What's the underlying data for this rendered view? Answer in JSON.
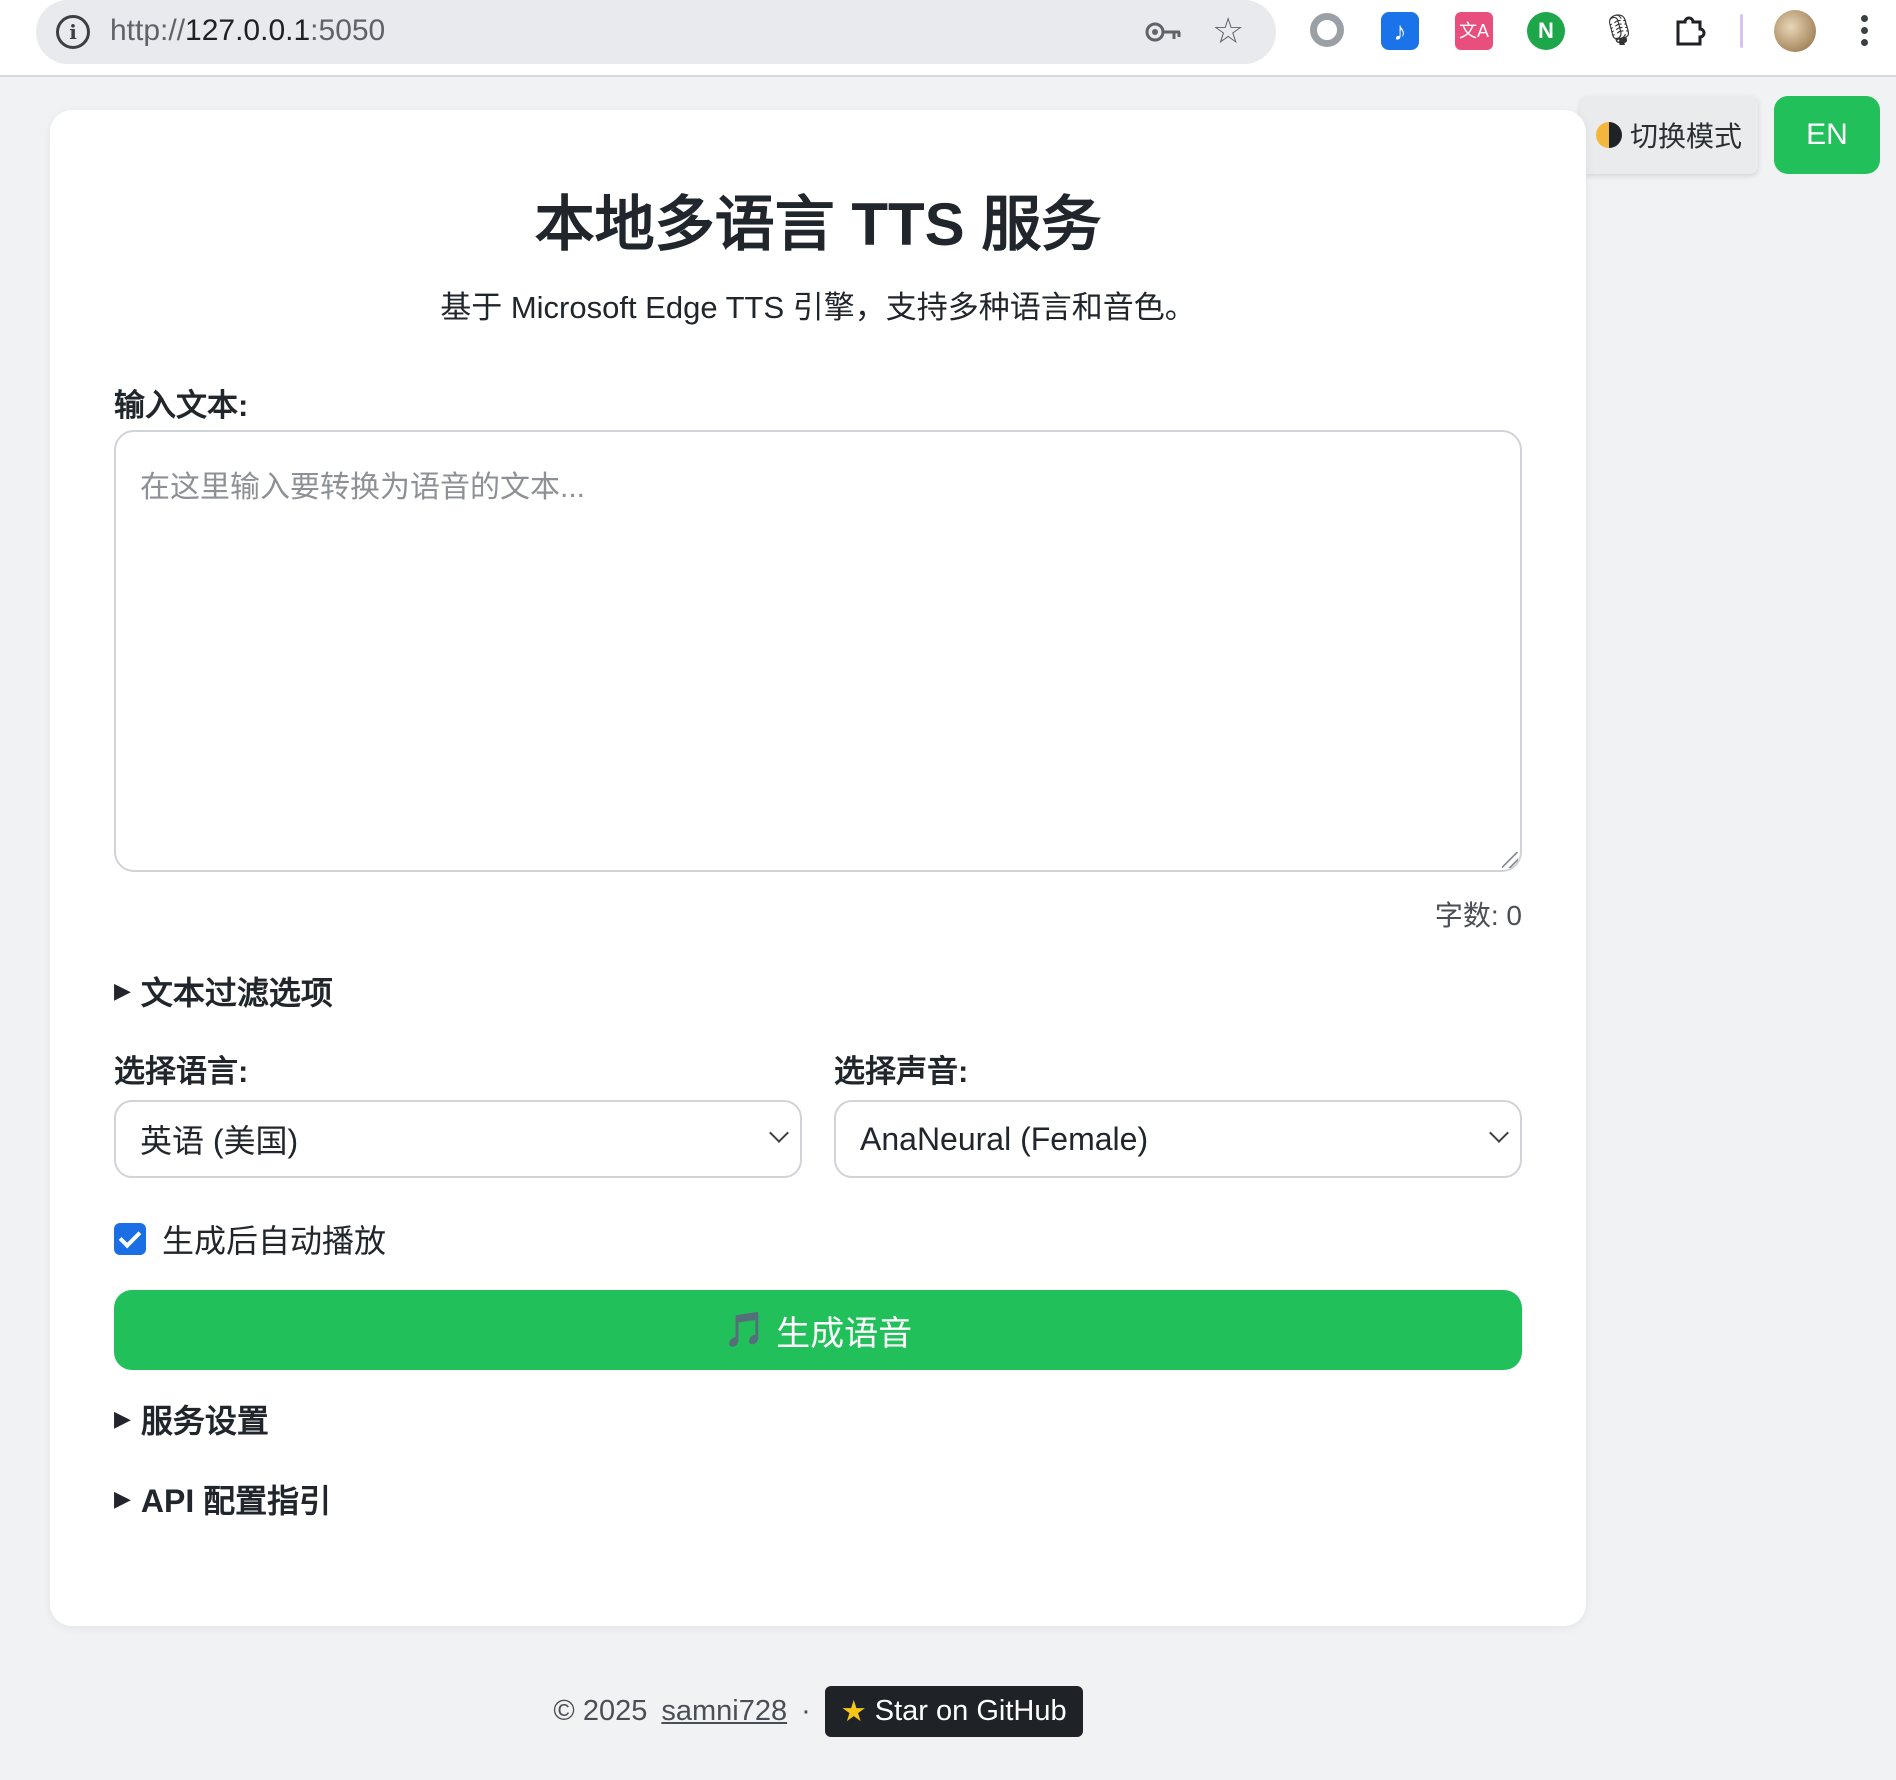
{
  "browser": {
    "url_scheme": "http://",
    "url_host": "127.0.0.1",
    "url_port": ":5050"
  },
  "controls": {
    "mode_toggle_label": "切换模式",
    "language_toggle_label": "EN"
  },
  "header": {
    "title": "本地多语言 TTS 服务",
    "subtitle": "基于 Microsoft Edge TTS 引擎，支持多种语言和音色。"
  },
  "input": {
    "label": "输入文本:",
    "placeholder": "在这里输入要转换为语音的文本...",
    "value": "",
    "char_count_label": "字数: 0"
  },
  "sections": {
    "filter_options": "文本过滤选项",
    "service_settings": "服务设置",
    "api_guide": "API 配置指引"
  },
  "language_select": {
    "label": "选择语言:",
    "selected": "英语 (美国)"
  },
  "voice_select": {
    "label": "选择声音:",
    "selected": "AnaNeural (Female)"
  },
  "autoplay": {
    "label": "生成后自动播放",
    "checked": true
  },
  "generate_button": {
    "label": "生成语音",
    "icon": "music-note-icon"
  },
  "footer": {
    "copyright": "© 2025",
    "author": "samni728",
    "separator": "·",
    "github_label": "Star on GitHub",
    "github_icon": "star-icon"
  },
  "colors": {
    "accent_green": "#22c05a",
    "checkbox_blue": "#1a6fe5",
    "page_bg": "#f1f2f4"
  }
}
